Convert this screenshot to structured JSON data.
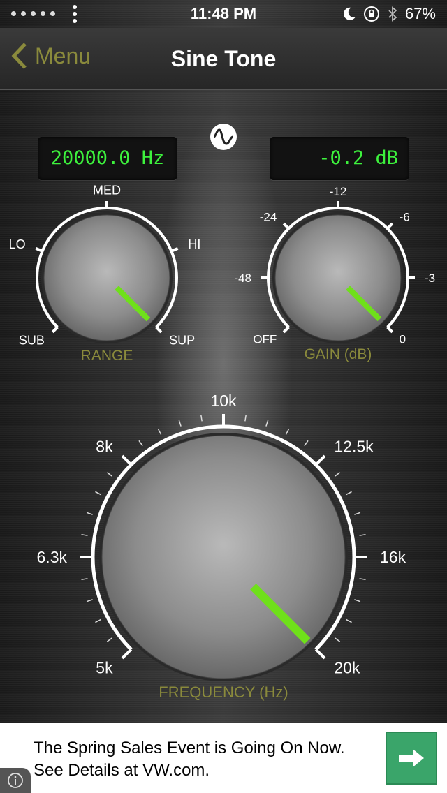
{
  "status_bar": {
    "time": "11:48 PM",
    "battery": "67%",
    "icons": [
      "signal-dots-icon",
      "menu-dots-icon",
      "moon-icon",
      "rotation-lock-icon",
      "bluetooth-icon",
      "battery-icon"
    ]
  },
  "nav": {
    "back_label": "Menu",
    "title": "Sine Tone"
  },
  "displays": {
    "frequency": "20000.0 Hz",
    "gain": "-0.2 dB"
  },
  "wave_icon": "sine-wave-icon",
  "range_knob": {
    "label": "RANGE",
    "ticks": [
      "SUB",
      "LO",
      "MED",
      "HI",
      "SUP"
    ],
    "selected": "SUP"
  },
  "gain_knob": {
    "label": "GAIN (dB)",
    "ticks": [
      "OFF",
      "-48",
      "-24",
      "-12",
      "-6",
      "-3",
      "0"
    ],
    "value_db": -0.2
  },
  "frequency_knob": {
    "label": "FREQUENCY (Hz)",
    "ticks": [
      "5k",
      "6.3k",
      "8k",
      "10k",
      "12.5k",
      "16k",
      "20k"
    ],
    "value_hz": 20000
  },
  "colors": {
    "indicator": "#6fe01a",
    "display_text": "#3df23d",
    "knob_label": "#8a8a3c",
    "back_label": "#8a8a3c",
    "ad_button": "#3aa56a"
  },
  "ad": {
    "line1": "The Spring Sales Event is Going On Now.",
    "line2": "See Details at VW.com.",
    "button_icon": "arrow-right-icon",
    "info_icon": "info-icon"
  }
}
